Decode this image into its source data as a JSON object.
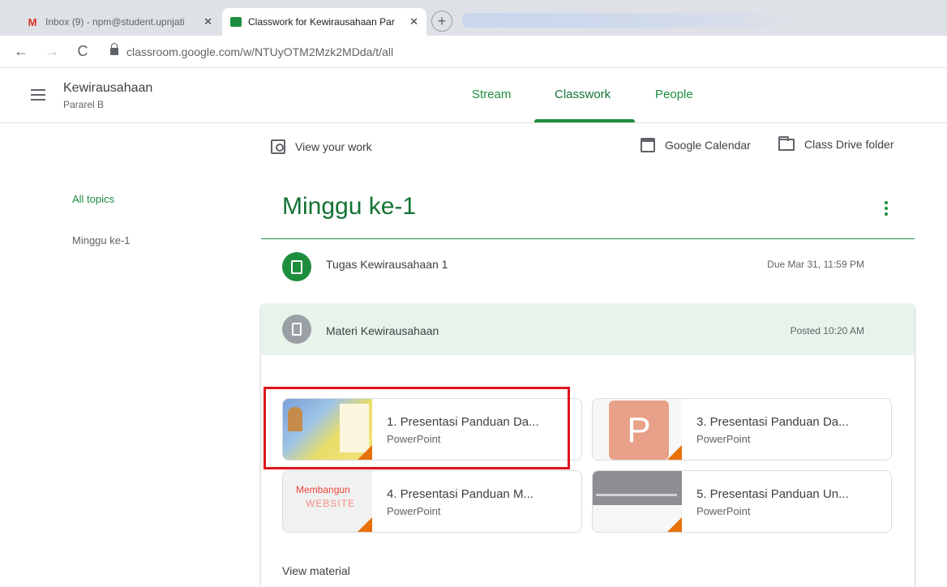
{
  "browser": {
    "tabs": [
      {
        "title": "Inbox (9) - npm@student.upnjati"
      },
      {
        "title": "Classwork for Kewirausahaan Par"
      }
    ],
    "url": "classroom.google.com/w/NTUyOTM2Mzk2MDda/t/all"
  },
  "header": {
    "class_name": "Kewirausahaan",
    "section": "Pararel B",
    "tabs": [
      {
        "label": "Stream"
      },
      {
        "label": "Classwork"
      },
      {
        "label": "People"
      }
    ]
  },
  "actions": {
    "view_work": "View your work",
    "calendar": "Google Calendar",
    "drive": "Class Drive folder"
  },
  "sidebar": {
    "items": [
      {
        "label": "All topics"
      },
      {
        "label": "Minggu ke-1"
      }
    ]
  },
  "topic": {
    "title": "Minggu ke-1",
    "assignment": {
      "title": "Tugas Kewirausahaan 1",
      "due": "Due Mar 31, 11:59 PM"
    },
    "material": {
      "title": "Materi Kewirausahaan",
      "posted": "Posted 10:20 AM",
      "attachments": [
        {
          "name": "1. Presentasi Panduan Da...",
          "type": "PowerPoint"
        },
        {
          "name": "3. Presentasi Panduan Da...",
          "type": "PowerPoint",
          "thumb_letter": "P"
        },
        {
          "name": "4. Presentasi Panduan M...",
          "type": "PowerPoint",
          "thumb_text": [
            "Membangun",
            "WEBSITE"
          ]
        },
        {
          "name": "5. Presentasi Panduan Un...",
          "type": "PowerPoint"
        }
      ],
      "view_label": "View material"
    }
  },
  "colors": {
    "accent": "#1e8e3e",
    "highlight_box": "#e0141e",
    "material_header": "#e6f4ea"
  }
}
